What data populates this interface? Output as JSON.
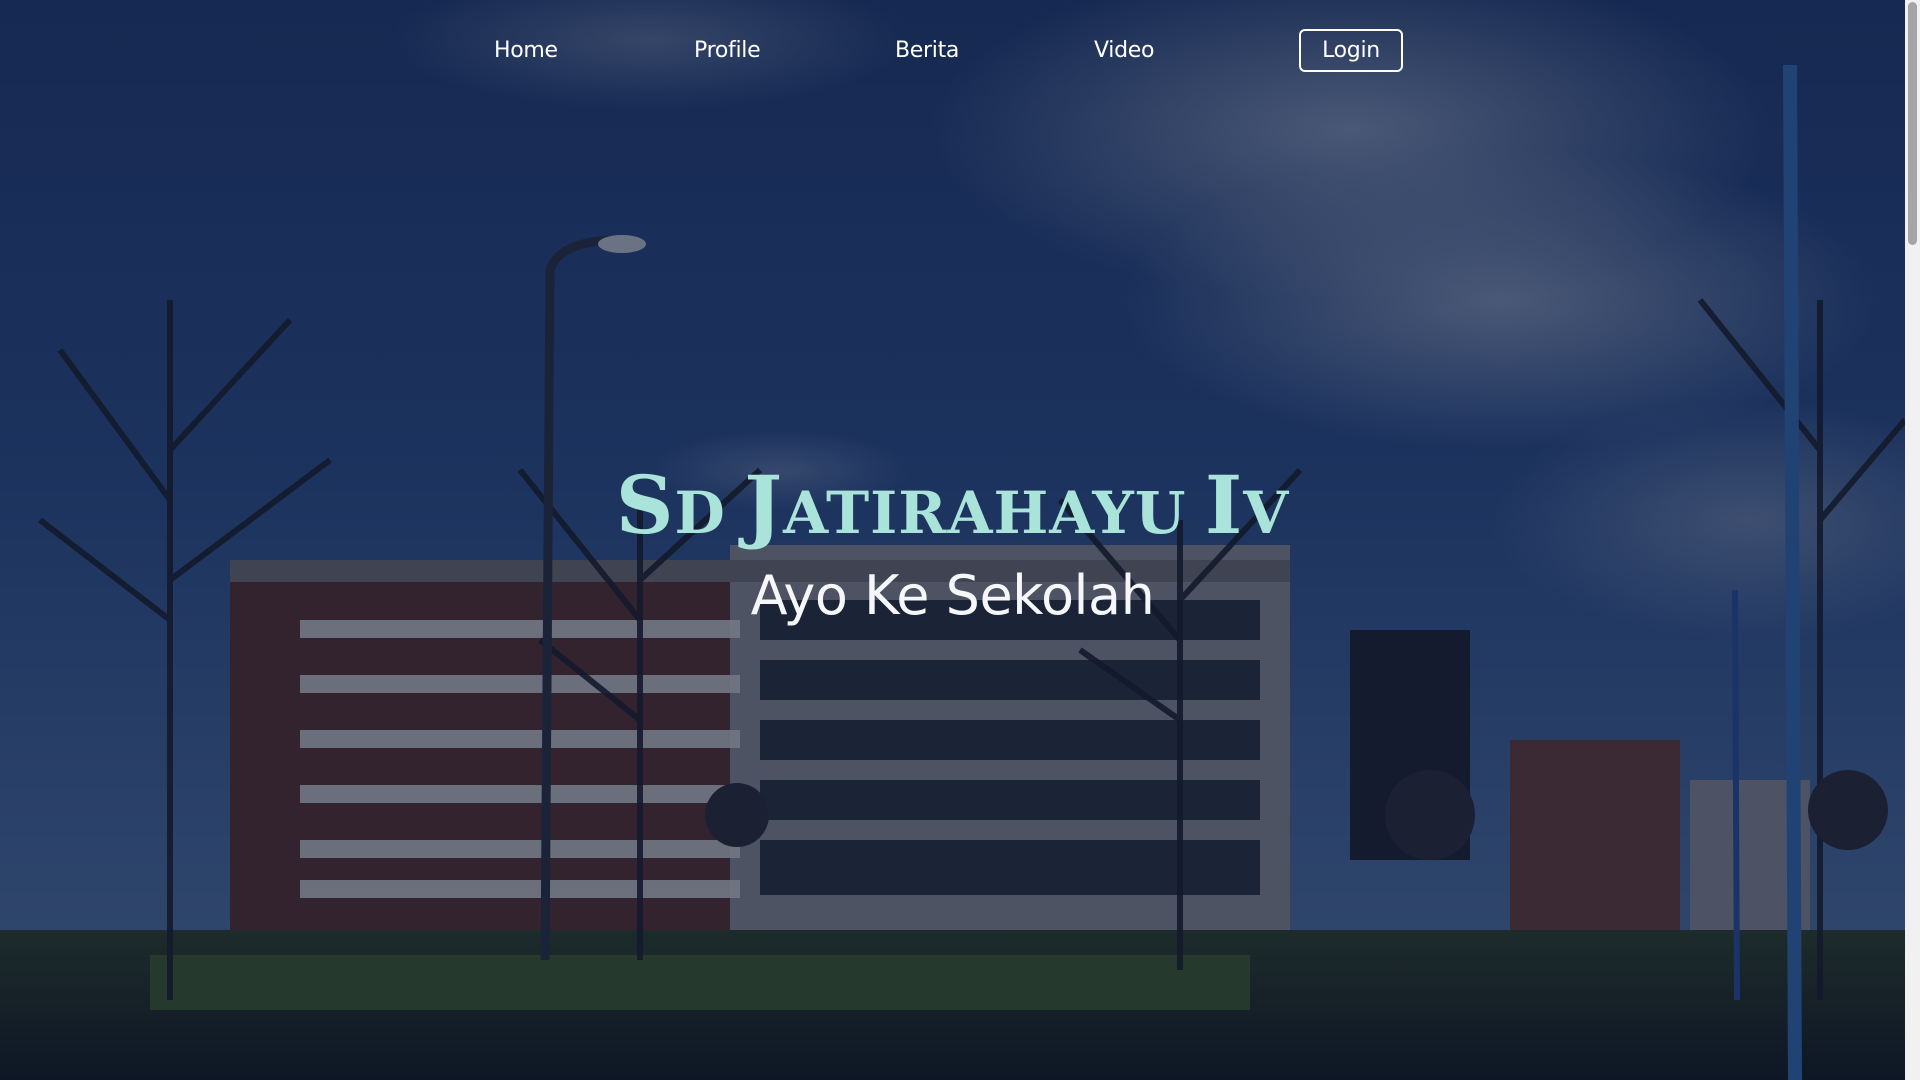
{
  "nav": {
    "items": [
      {
        "label": "Home"
      },
      {
        "label": "Profile"
      },
      {
        "label": "Berita"
      },
      {
        "label": "Video"
      }
    ],
    "login_label": "Login"
  },
  "hero": {
    "title": "Sd Jatirahayu Iv",
    "subtitle": "Ayo Ke Sekolah",
    "title_color": "#a9e3d9",
    "background_description_icon": "school-building-photo"
  },
  "colors": {
    "nav_text": "#ffffff",
    "overlay": "#0b1838"
  }
}
